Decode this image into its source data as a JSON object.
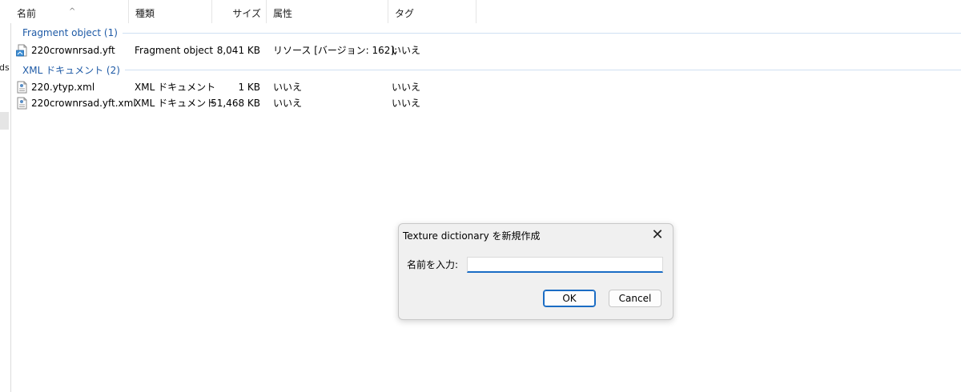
{
  "left_pane": {
    "truncated_label": "ds"
  },
  "columns": {
    "name": "名前",
    "type": "種類",
    "size": "サイズ",
    "attr": "属性",
    "tag": "タグ",
    "sort_indicator": "^"
  },
  "groups": [
    {
      "label": "Fragment object (1)",
      "rows": [
        {
          "icon": "yft-file-icon",
          "name": "220crownrsad.yft",
          "type": "Fragment object",
          "size": "8,041 KB",
          "attr": "リソース [バージョン: 162];",
          "tag": "いいえ"
        }
      ]
    },
    {
      "label": "XML ドキュメント (2)",
      "rows": [
        {
          "icon": "xml-file-icon",
          "name": "220.ytyp.xml",
          "type": "XML ドキュメント",
          "size": "1 KB",
          "attr": "いいえ",
          "tag": "いいえ"
        },
        {
          "icon": "xml-file-icon",
          "name": "220crownrsad.yft.xml",
          "type": "XML ドキュメント",
          "size": "51,468 KB",
          "attr": "いいえ",
          "tag": "いいえ"
        }
      ]
    }
  ],
  "dialog": {
    "title": "Texture dictionary を新規作成",
    "close_glyph": "✕",
    "input_label": "名前を入力:",
    "input_value": "",
    "ok_label": "OK",
    "cancel_label": "Cancel"
  },
  "colors": {
    "group_header": "#1e5aa6",
    "focus_accent": "#1a6cc4",
    "dialog_bg": "#f0f0f0"
  }
}
